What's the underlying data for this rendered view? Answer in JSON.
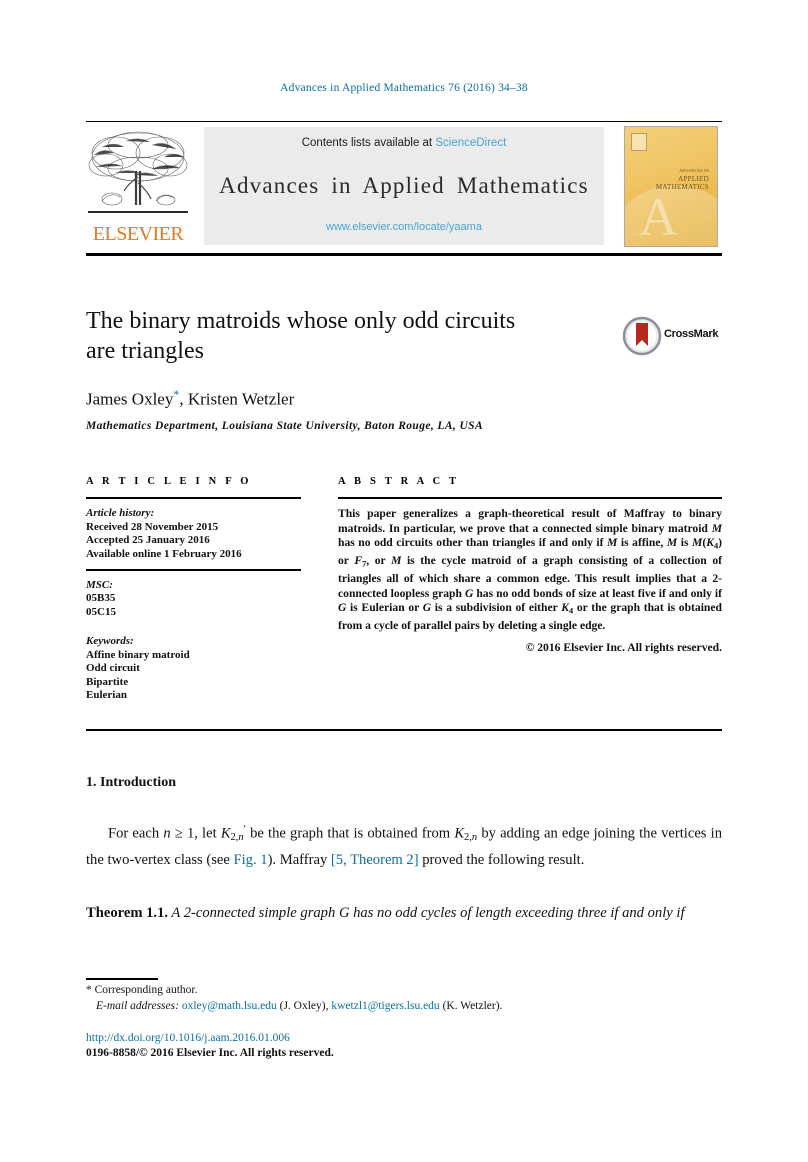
{
  "running_head": "Advances in Applied Mathematics 76 (2016) 34–38",
  "masthead": {
    "publisher_wordmark": "ELSEVIER",
    "contents_prefix": "Contents lists available at",
    "contents_link": "ScienceDirect",
    "journal_name": "Advances in Applied Mathematics",
    "journal_url": "www.elsevier.com/locate/yaama",
    "cover": {
      "top_line": "ADVANCES IN",
      "line1": "APPLIED",
      "line2": "MATHEMATICS",
      "watermark": "A"
    }
  },
  "article": {
    "title_line1": "The binary matroids whose only odd circuits",
    "title_line2": "are triangles",
    "crossmark_label": "CrossMark",
    "authors": "James Oxley",
    "author_star": "*",
    "authors_rest": ", Kristen Wetzler",
    "affiliation": "Mathematics Department, Louisiana State University, Baton Rouge, LA, USA"
  },
  "info": {
    "heading": "A R T I C L E   I N F O",
    "history_label": "Article history:",
    "history": [
      "Received 28 November 2015",
      "Accepted 25 January 2016",
      "Available online 1 February 2016"
    ],
    "msc_label": "MSC:",
    "msc": [
      "05B35",
      "05C15"
    ],
    "keywords_label": "Keywords:",
    "keywords": [
      "Affine binary matroid",
      "Odd circuit",
      "Bipartite",
      "Eulerian"
    ]
  },
  "abstract": {
    "heading": "A B S T R A C T",
    "copyright": "© 2016 Elsevier Inc. All rights reserved."
  },
  "body": {
    "section_number": "1.",
    "section_title": "Introduction",
    "theorem_label": "Theorem 1.1.",
    "link_fig": "Fig. 1",
    "link_ref": "[5, Theorem 2]"
  },
  "footnotes": {
    "corresponding": "Corresponding author.",
    "emails_label": "E-mail addresses:",
    "email1": "oxley@math.lsu.edu",
    "email1_owner": "(J. Oxley),",
    "email2": "kwetzl1@tigers.lsu.edu",
    "email2_owner": "(K. Wetzler).",
    "doi": "http://dx.doi.org/10.1016/j.aam.2016.01.006",
    "issn": "0196-8858/© 2016 Elsevier Inc. All rights reserved."
  },
  "colors": {
    "link_blue": "#0b6e9c",
    "sciencedirect_blue": "#4ba3d3",
    "elsevier_orange": "#e87722",
    "crossmark_red": "#b5281e"
  }
}
